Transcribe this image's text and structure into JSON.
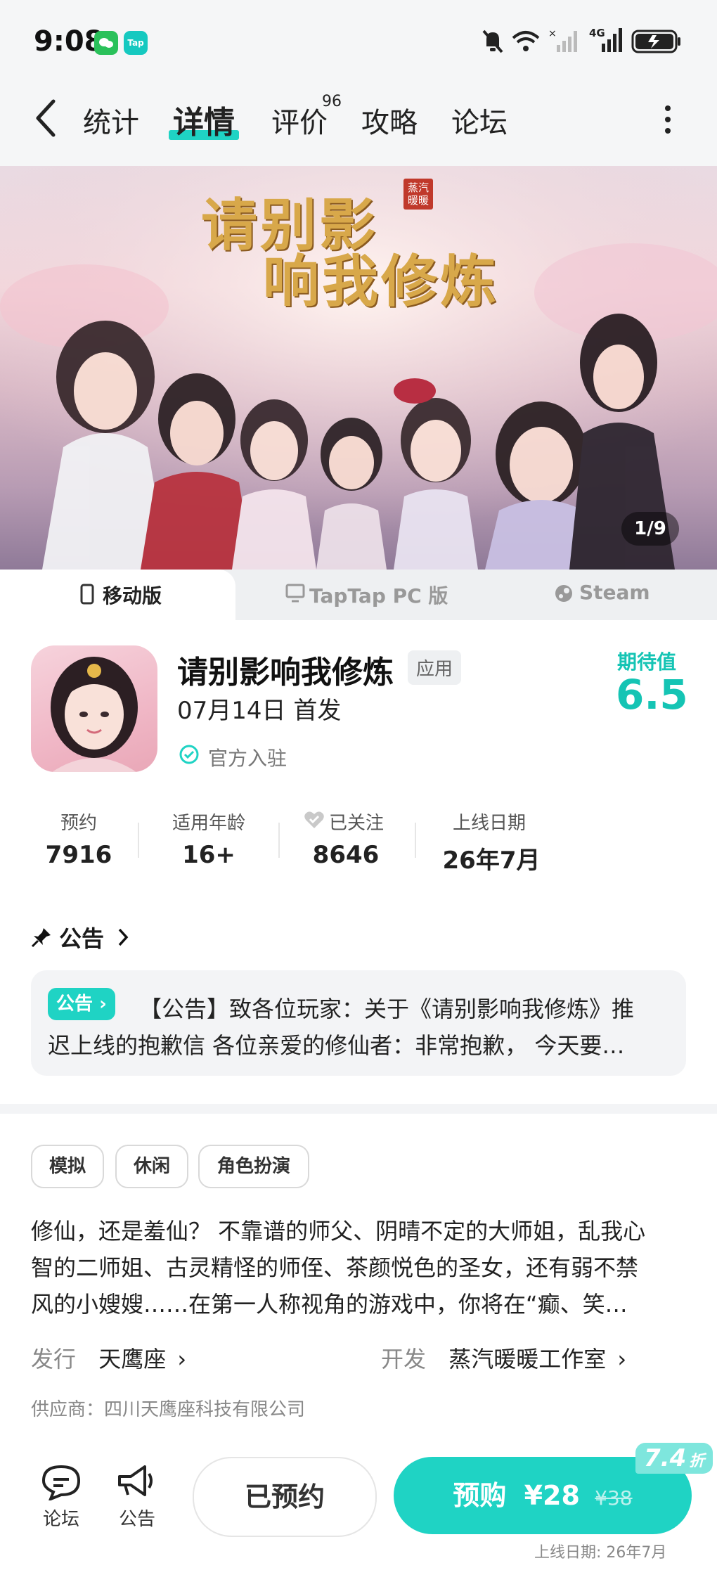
{
  "status_bar": {
    "time": "9:08",
    "network": "4G"
  },
  "nav": {
    "tabs": [
      {
        "label": "统计"
      },
      {
        "label": "详情"
      },
      {
        "label": "评价",
        "badge": "96"
      },
      {
        "label": "攻略"
      },
      {
        "label": "论坛"
      }
    ]
  },
  "banner": {
    "title_line1": "请别影",
    "title_line2": "响我修炼",
    "seal_text": "蒸汽暖暖",
    "counter": "1/9"
  },
  "platforms": [
    {
      "label": "移动版"
    },
    {
      "label": "TapTap PC 版"
    },
    {
      "label": "Steam"
    }
  ],
  "app": {
    "name": "请别影响我修炼",
    "type_tag": "应用",
    "release": "07月14日 首发",
    "official": "官方入驻",
    "expect_label": "期待值",
    "expect_score": "6.5"
  },
  "stats": [
    {
      "label": "预约",
      "value": "7916"
    },
    {
      "label": "适用年龄",
      "value": "16+"
    },
    {
      "label": "已关注",
      "value": "8646"
    },
    {
      "label": "上线日期",
      "value": "26年7月"
    }
  ],
  "notice": {
    "header": "公告",
    "chip": "公告",
    "line1": "【公告】致各位玩家：关于《请别影响我修炼》推",
    "line2": "迟上线的抱歉信 各位亲爱的修仙者：非常抱歉， 今天要…"
  },
  "tags": [
    "模拟",
    "休闲",
    "角色扮演"
  ],
  "description": [
    "修仙，还是羞仙？ 不靠谱的师父、阴晴不定的大师姐，乱我心",
    "智的二师姐、古灵精怪的师侄、茶颜悦色的圣女，还有弱不禁",
    "风的小嫂嫂……在第一人称视角的游戏中，你将在“癫、笑…"
  ],
  "meta": {
    "publisher_label": "发行",
    "publisher": "天鹰座",
    "developer_label": "开发",
    "developer": "蒸汽暖暖工作室",
    "supplier": "供应商：四川天鹰座科技有限公司"
  },
  "bottom": {
    "forum_label": "论坛",
    "notice_label": "公告",
    "reserved_label": "已预约",
    "buy_label": "预购",
    "price": "¥28",
    "original_price": "¥38",
    "discount": "7.4",
    "discount_unit": "折",
    "launch_note": "上线日期: 26年7月"
  },
  "colors": {
    "accent": "#1fd3c4"
  }
}
